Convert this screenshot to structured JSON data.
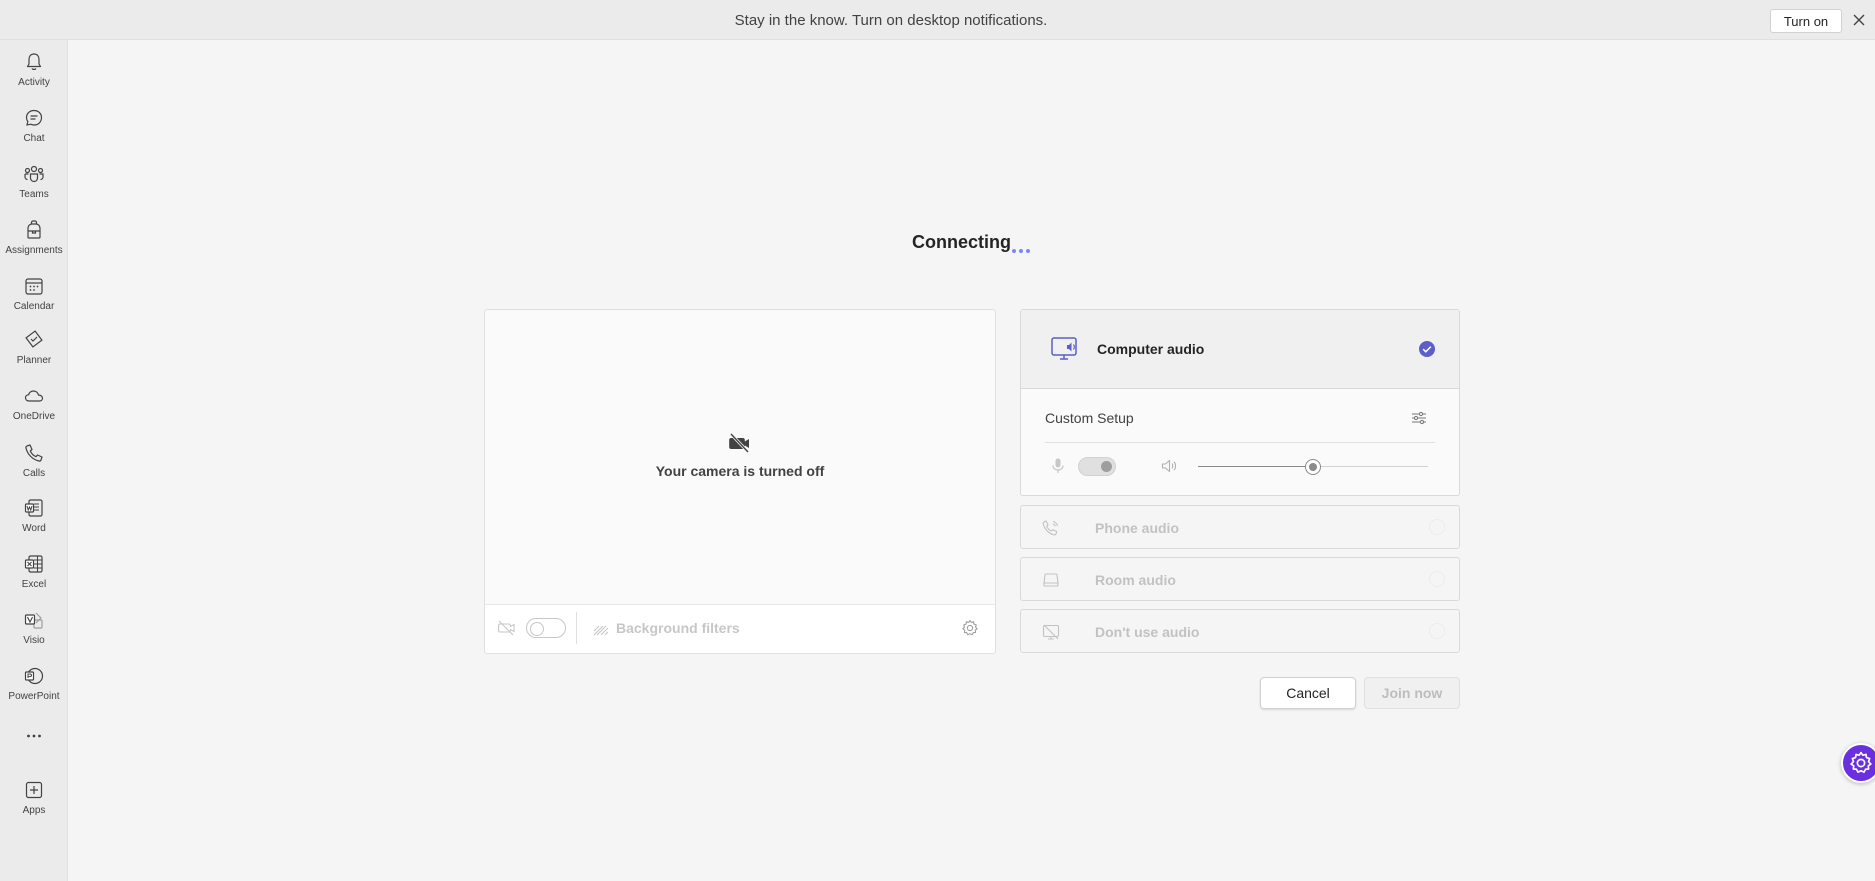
{
  "notification": {
    "text": "Stay in the know. Turn on desktop notifications.",
    "button_label": "Turn on"
  },
  "rail": {
    "items": [
      {
        "label": "Activity",
        "icon": "bell-icon"
      },
      {
        "label": "Chat",
        "icon": "chat-icon"
      },
      {
        "label": "Teams",
        "icon": "teams-icon"
      },
      {
        "label": "Assignments",
        "icon": "backpack-icon"
      },
      {
        "label": "Calendar",
        "icon": "calendar-icon"
      },
      {
        "label": "Planner",
        "icon": "planner-icon"
      },
      {
        "label": "OneDrive",
        "icon": "cloud-icon"
      },
      {
        "label": "Calls",
        "icon": "phone-icon"
      },
      {
        "label": "Word",
        "icon": "word-icon"
      },
      {
        "label": "Excel",
        "icon": "excel-icon"
      },
      {
        "label": "Visio",
        "icon": "visio-icon"
      },
      {
        "label": "PowerPoint",
        "icon": "powerpoint-icon"
      },
      {
        "label": "",
        "icon": "more-icon"
      },
      {
        "label": "Apps",
        "icon": "add-app-icon"
      }
    ]
  },
  "main": {
    "status": "Connecting",
    "camera_off_text": "Your camera is turned off",
    "background_filters_label": "Background filters",
    "camera_toggle_on": false
  },
  "audio": {
    "computer_audio_label": "Computer audio",
    "computer_audio_selected": true,
    "custom_setup_label": "Custom Setup",
    "mic_on": true,
    "speaker_volume_fraction": 0.5,
    "options": [
      {
        "label": "Phone audio",
        "icon": "phone-audio-icon"
      },
      {
        "label": "Room audio",
        "icon": "room-audio-icon"
      },
      {
        "label": "Don't use audio",
        "icon": "no-audio-icon"
      }
    ]
  },
  "actions": {
    "cancel_label": "Cancel",
    "join_label": "Join now"
  },
  "colors": {
    "accent": "#5b5fc7",
    "floating_button": "#6b2fe0"
  }
}
